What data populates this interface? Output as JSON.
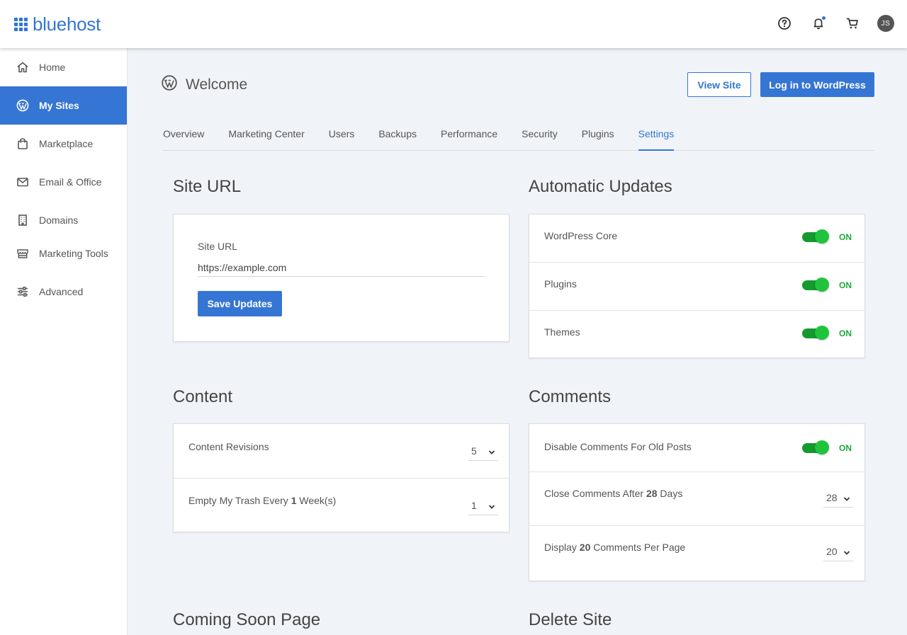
{
  "brand": {
    "name": "bluehost",
    "color": "#3575d3"
  },
  "header": {
    "icons": [
      "help-icon",
      "bell-icon",
      "cart-icon"
    ],
    "avatar_initials": "JS"
  },
  "sidebar": {
    "items": [
      {
        "label": "Home",
        "icon": "home-icon",
        "active": false
      },
      {
        "label": "My Sites",
        "icon": "wordpress-icon",
        "active": true
      },
      {
        "label": "Marketplace",
        "icon": "shopping-bag-icon",
        "active": false
      },
      {
        "label": "Email & Office",
        "icon": "envelope-icon",
        "active": false
      },
      {
        "label": "Domains",
        "icon": "building-icon",
        "active": false
      },
      {
        "label": "Marketing Tools",
        "icon": "store-icon",
        "active": false
      },
      {
        "label": "Advanced",
        "icon": "sliders-icon",
        "active": false
      }
    ]
  },
  "page": {
    "title": "Welcome",
    "view_site_label": "View Site",
    "login_label": "Log in to WordPress"
  },
  "tabs": [
    {
      "label": "Overview",
      "active": false
    },
    {
      "label": "Marketing Center",
      "active": false
    },
    {
      "label": "Users",
      "active": false
    },
    {
      "label": "Backups",
      "active": false
    },
    {
      "label": "Performance",
      "active": false
    },
    {
      "label": "Security",
      "active": false
    },
    {
      "label": "Plugins",
      "active": false
    },
    {
      "label": "Settings",
      "active": true
    }
  ],
  "site_url": {
    "heading": "Site URL",
    "field_label": "Site URL",
    "value": "https://example.com",
    "save_label": "Save Updates"
  },
  "auto_updates": {
    "heading": "Automatic Updates",
    "rows": [
      {
        "label": "WordPress Core",
        "state": "ON"
      },
      {
        "label": "Plugins",
        "state": "ON"
      },
      {
        "label": "Themes",
        "state": "ON"
      }
    ]
  },
  "content": {
    "heading": "Content",
    "revisions": {
      "label": "Content Revisions",
      "value": "5"
    },
    "trash": {
      "prefix": "Empty My Trash Every",
      "count": "1",
      "suffix": "Week(s)",
      "value": "1"
    }
  },
  "comments": {
    "heading": "Comments",
    "disable_old": {
      "label": "Disable Comments For Old Posts",
      "state": "ON"
    },
    "close_after": {
      "prefix": "Close Comments After",
      "count": "28",
      "suffix": "Days",
      "value": "28"
    },
    "per_page": {
      "prefix": "Display",
      "count": "20",
      "suffix": "Comments Per Page",
      "value": "20"
    }
  },
  "coming_soon": {
    "heading": "Coming Soon Page"
  },
  "delete_site": {
    "heading": "Delete Site"
  }
}
